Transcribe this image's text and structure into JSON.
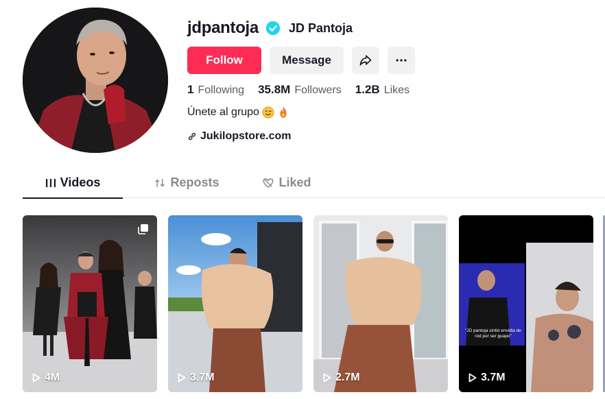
{
  "profile": {
    "username": "jdpantoja",
    "nickname": "JD Pantoja",
    "verified": true,
    "bio": "Únete al grupo",
    "bio_emojis": [
      "wink-face-emoji",
      "fire-emoji"
    ],
    "link": "Jukilopstore.com"
  },
  "actions": {
    "follow_label": "Follow",
    "message_label": "Message",
    "share_icon": "share-icon",
    "more_icon": "more-icon"
  },
  "stats": {
    "following_count": "1",
    "following_label": "Following",
    "followers_count": "35.8M",
    "followers_label": "Followers",
    "likes_count": "1.2B",
    "likes_label": "Likes"
  },
  "tabs": [
    {
      "label": "Videos",
      "icon": "grid-icon",
      "active": true
    },
    {
      "label": "Reposts",
      "icon": "repost-icon",
      "active": false
    },
    {
      "label": "Liked",
      "icon": "heart-icon",
      "active": false
    }
  ],
  "videos": [
    {
      "views": "4M",
      "multi_image": true,
      "caption": ""
    },
    {
      "views": "3.7M",
      "multi_image": false,
      "caption": ""
    },
    {
      "views": "2.7M",
      "multi_image": false,
      "caption": ""
    },
    {
      "views": "3.7M",
      "multi_image": false,
      "caption": "\"JD pantoja sintió envidia de rod por ser guapo\""
    }
  ],
  "colors": {
    "accent": "#fe2c55",
    "verified": "#20d5ec",
    "text_primary": "#161823",
    "text_secondary": "#5a5b63",
    "button_gray": "#f1f1f2"
  }
}
